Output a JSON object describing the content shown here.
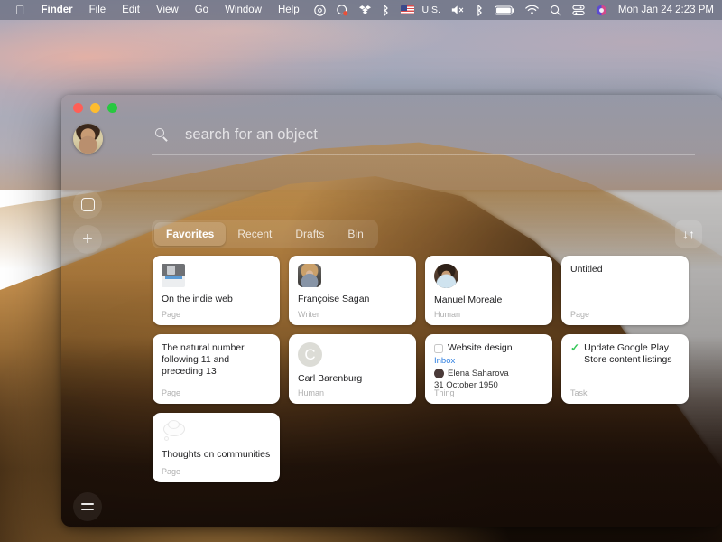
{
  "menubar": {
    "apple_logo": "",
    "items": [
      {
        "label": "Finder",
        "bold": true
      },
      {
        "label": "File",
        "bold": false
      },
      {
        "label": "Edit",
        "bold": false
      },
      {
        "label": "View",
        "bold": false
      },
      {
        "label": "Go",
        "bold": false
      },
      {
        "label": "Window",
        "bold": false
      },
      {
        "label": "Help",
        "bold": false
      }
    ],
    "status_icons": [
      "cd-burner-icon",
      "record-icon",
      "dropbox-icon",
      "bluetooth-alt-icon"
    ],
    "input_language": "U.S.",
    "right_icons": [
      "volume-mute-icon",
      "bluetooth-icon",
      "battery-icon",
      "wifi-icon",
      "spotlight-search-icon",
      "control-center-icon",
      "siri-icon"
    ],
    "clock": "Mon Jan 24  2:23 PM"
  },
  "window": {
    "traffic_lights": [
      "close",
      "minimize",
      "zoom"
    ],
    "avatar": "user-avatar",
    "rail": {
      "objects_icon": "rounded-square-icon",
      "add_icon": "+",
      "menu_icon": "hamburger-icon"
    },
    "search": {
      "icon": "search-icon",
      "placeholder": "search for an object",
      "value": ""
    },
    "tabs": [
      {
        "label": "Favorites",
        "active": true
      },
      {
        "label": "Recent",
        "active": false
      },
      {
        "label": "Drafts",
        "active": false
      },
      {
        "label": "Bin",
        "active": false
      }
    ],
    "sort_button": {
      "icon": "sort-arrows-icon",
      "glyph": "↓↑"
    },
    "cards": [
      {
        "id": "on-the-indie-web",
        "layout": "icon-title",
        "icon": "floppy-disk-icon",
        "title": "On the indie web",
        "subtitle": "Page"
      },
      {
        "id": "francoise-sagan",
        "layout": "thumb-title",
        "icon": "portrait-thumbnail",
        "title": "Françoise Sagan",
        "subtitle": "Writer"
      },
      {
        "id": "manuel-moreale",
        "layout": "avatar-title",
        "icon": "portrait-avatar",
        "title": "Manuel Moreale",
        "subtitle": "Human"
      },
      {
        "id": "untitled",
        "layout": "title-only",
        "icon": "",
        "title": "Untitled",
        "subtitle": "Page"
      },
      {
        "id": "natural-number-12",
        "layout": "title-only-top",
        "icon": "",
        "title": "The natural number following 11 and preceding 13",
        "subtitle": "Page"
      },
      {
        "id": "carl-barenburg",
        "layout": "letter-title",
        "icon": "letter-avatar",
        "letter": "C",
        "title": "Carl Barenburg",
        "subtitle": "Human"
      },
      {
        "id": "website-design",
        "layout": "task-detail",
        "icon": "checkbox-unchecked-icon",
        "title": "Website design",
        "link": "Inbox",
        "person": "Elena Saharova",
        "person_avatar": "person-avatar",
        "date": "31 October 1950",
        "subtitle": "Thing"
      },
      {
        "id": "update-google-play",
        "layout": "check-title",
        "icon": "checkmark-green-icon",
        "title": "Update Google Play Store content listings",
        "subtitle": "Task"
      },
      {
        "id": "thoughts-on-communities",
        "layout": "icon-title",
        "icon": "thought-bubble-icon",
        "title": "Thoughts on communities",
        "subtitle": "Page"
      }
    ]
  },
  "colors": {
    "accent_link": "#2f7fe0",
    "check_green": "#35c759",
    "card_bg": "#ffffff",
    "traffic_red": "#ff5f57",
    "traffic_yellow": "#febc2e",
    "traffic_green": "#28c840"
  }
}
